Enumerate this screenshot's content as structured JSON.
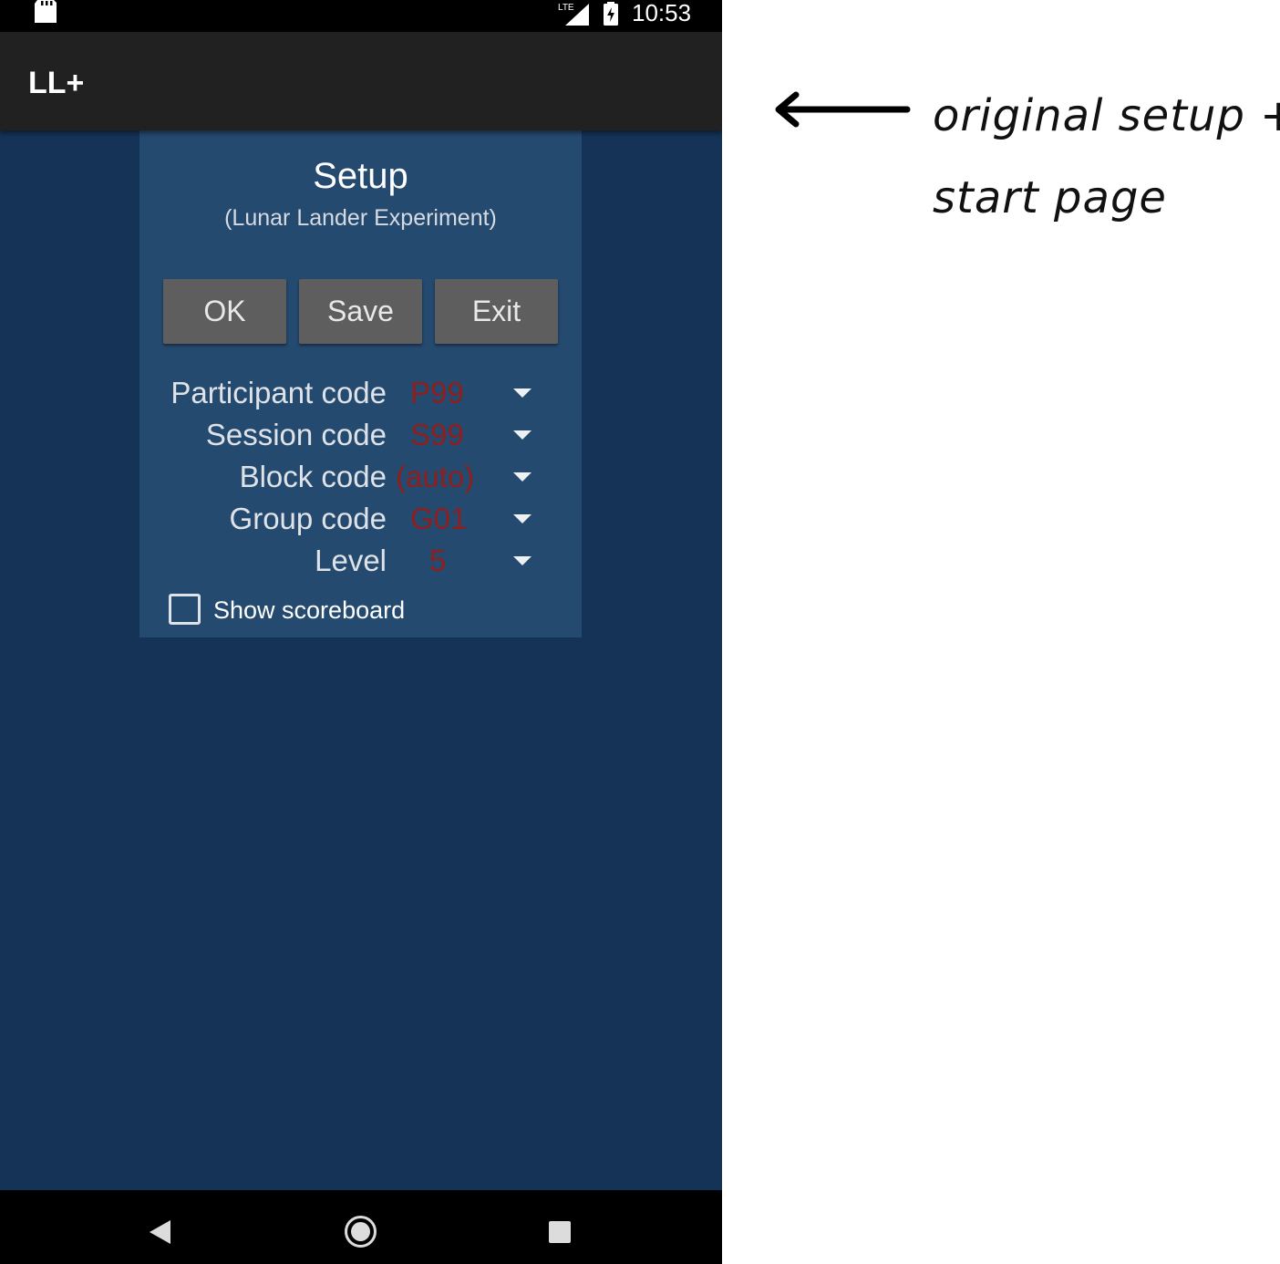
{
  "status_bar": {
    "time": "10:53",
    "network": "LTE",
    "icons": [
      "sd-card-icon",
      "signal-icon",
      "battery-charging-icon"
    ]
  },
  "app_bar": {
    "title": "LL+"
  },
  "setup": {
    "title": "Setup",
    "subtitle": "(Lunar Lander Experiment)",
    "buttons": {
      "ok": "OK",
      "save": "Save",
      "exit": "Exit"
    },
    "fields": [
      {
        "label": "Participant code",
        "value": "P99"
      },
      {
        "label": "Session code",
        "value": "S99"
      },
      {
        "label": "Block code",
        "value": "(auto)"
      },
      {
        "label": "Group code",
        "value": "G01"
      },
      {
        "label": "Level",
        "value": "5"
      }
    ],
    "show_scoreboard": {
      "label": "Show scoreboard",
      "checked": false
    }
  },
  "nav_bar": {
    "icons": [
      "back-icon",
      "home-icon",
      "recents-icon"
    ]
  },
  "annotation": {
    "line1": "original setup +",
    "line2": "start page"
  },
  "colors": {
    "background": "#143356",
    "panel": "#254a70",
    "app_bar": "#212121",
    "button": "#5e5e5e",
    "value_text": "#8e1f1c"
  }
}
